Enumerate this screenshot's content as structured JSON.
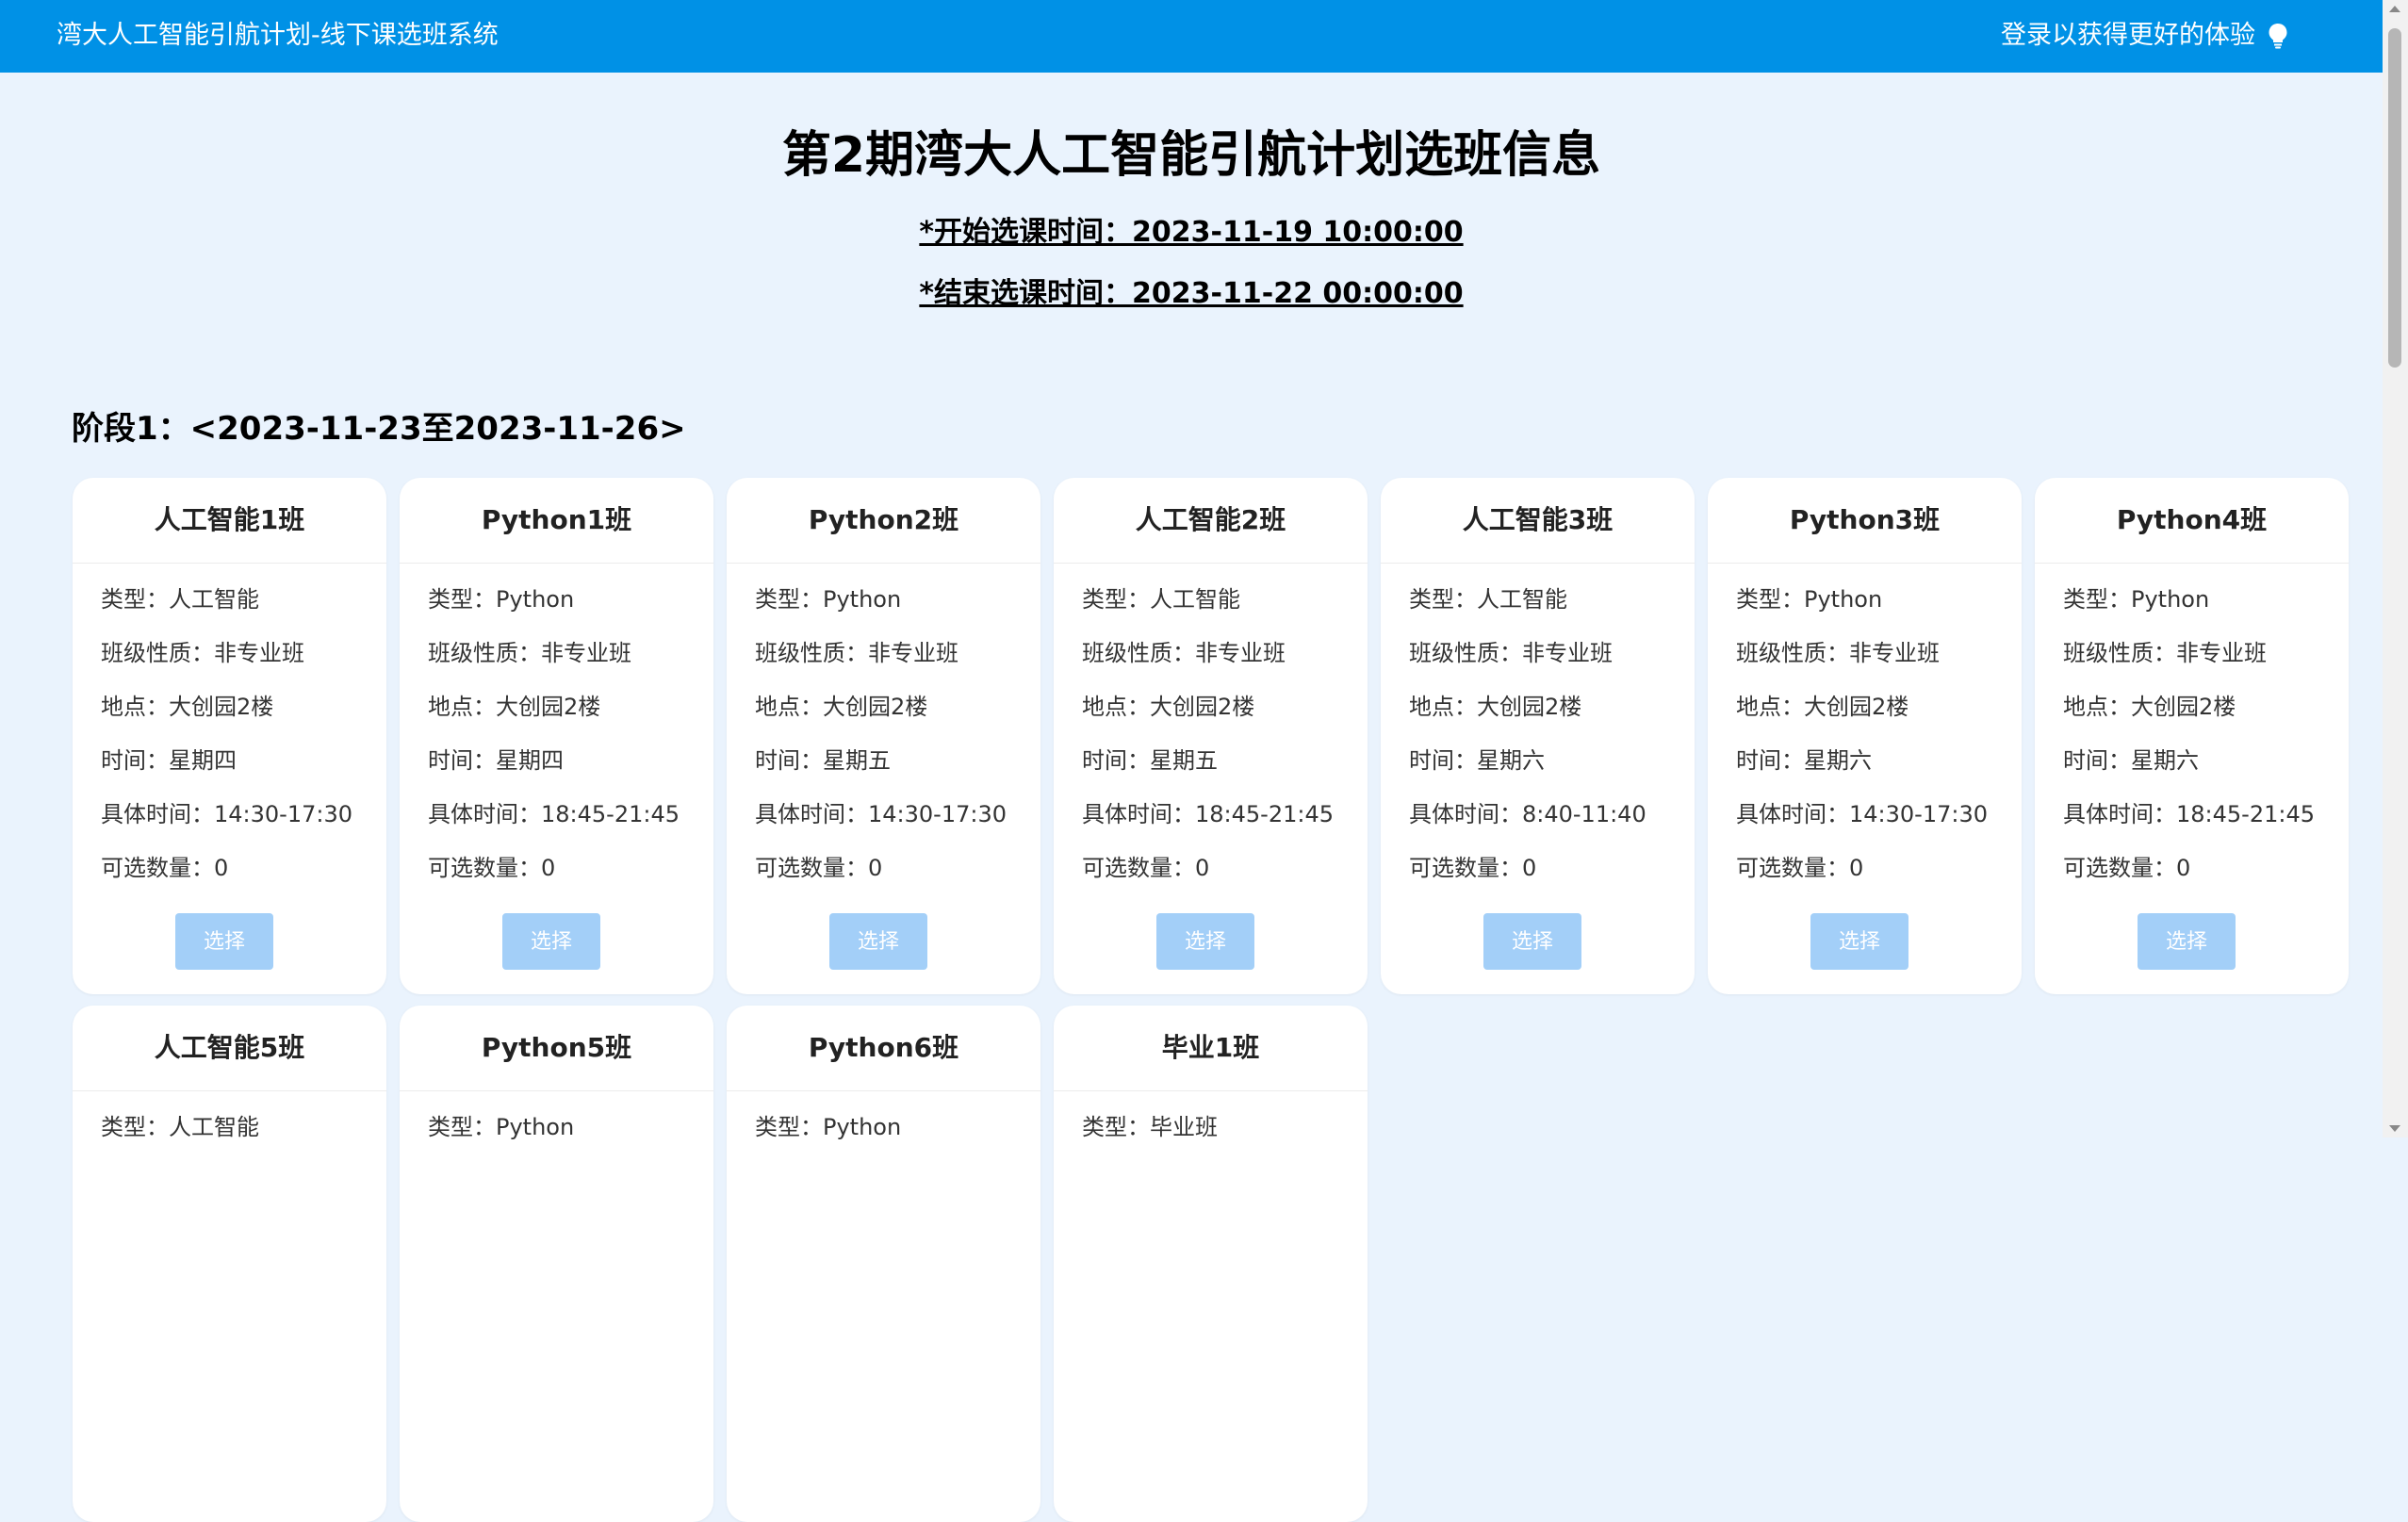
{
  "header": {
    "app_title": "湾大人工智能引航计划-线下课选班系统",
    "login_text": "登录以获得更好的体验",
    "login_icon": "lightbulb-icon"
  },
  "main": {
    "heading": "第2期湾大人工智能引航计划选班信息",
    "start_time": "*开始选课时间：2023-11-19 10:00:00",
    "end_time": "*结束选课时间：2023-11-22 00:00:00",
    "stage_title": "阶段1：<2023-11-23至2023-11-26>"
  },
  "labels": {
    "type": "类型：",
    "nature": "班级性质：",
    "place": "地点：",
    "day": "时间：",
    "time": "具体时间：",
    "quota": "可选数量：",
    "select_button": "选择"
  },
  "classes": [
    {
      "name": "人工智能1班",
      "type": "人工智能",
      "nature": "非专业班",
      "place": "大创园2楼",
      "day": "星期四",
      "time": "14:30-17:30",
      "quota": "0"
    },
    {
      "name": "Python1班",
      "type": "Python",
      "nature": "非专业班",
      "place": "大创园2楼",
      "day": "星期四",
      "time": "18:45-21:45",
      "quota": "0"
    },
    {
      "name": "Python2班",
      "type": "Python",
      "nature": "非专业班",
      "place": "大创园2楼",
      "day": "星期五",
      "time": "14:30-17:30",
      "quota": "0"
    },
    {
      "name": "人工智能2班",
      "type": "人工智能",
      "nature": "非专业班",
      "place": "大创园2楼",
      "day": "星期五",
      "time": "18:45-21:45",
      "quota": "0"
    },
    {
      "name": "人工智能3班",
      "type": "人工智能",
      "nature": "非专业班",
      "place": "大创园2楼",
      "day": "星期六",
      "time": "8:40-11:40",
      "quota": "0"
    },
    {
      "name": "Python3班",
      "type": "Python",
      "nature": "非专业班",
      "place": "大创园2楼",
      "day": "星期六",
      "time": "14:30-17:30",
      "quota": "0"
    },
    {
      "name": "Python4班",
      "type": "Python",
      "nature": "非专业班",
      "place": "大创园2楼",
      "day": "星期六",
      "time": "18:45-21:45",
      "quota": "0"
    },
    {
      "name": "人工智能5班",
      "type": "人工智能"
    },
    {
      "name": "Python5班",
      "type": "Python"
    },
    {
      "name": "Python6班",
      "type": "Python"
    },
    {
      "name": "毕业1班",
      "type": "毕业班"
    }
  ],
  "colors": {
    "header_bg": "#0091e6",
    "page_bg": "#eaf3fd",
    "button_disabled": "#a3cff8"
  }
}
